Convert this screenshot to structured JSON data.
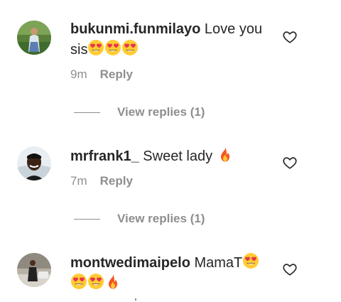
{
  "comments": [
    {
      "username": "bukunmi.funmilayo",
      "text_before": "Love you sis",
      "emojis_after": [
        "heart-eyes-emoji",
        "heart-eyes-emoji",
        "heart-eyes-emoji"
      ],
      "time": "9m",
      "reply_label": "Reply",
      "view_replies_label": "View replies (1)"
    },
    {
      "username": "mrfrank1_",
      "text_before": "Sweet lady",
      "emojis_after": [
        "fire-emoji"
      ],
      "time": "7m",
      "reply_label": "Reply",
      "view_replies_label": "View replies (1)"
    },
    {
      "username": "montwedimaipelo",
      "text_before": "MamaT",
      "emojis_after": [
        "heart-eyes-emoji",
        "heart-eyes-emoji",
        "heart-eyes-emoji",
        "fire-emoji"
      ]
    }
  ],
  "icons": {
    "like": "heart-outline-icon"
  },
  "colors": {
    "text": "#262626",
    "secondary": "#8e8e8e",
    "background": "#ffffff"
  }
}
